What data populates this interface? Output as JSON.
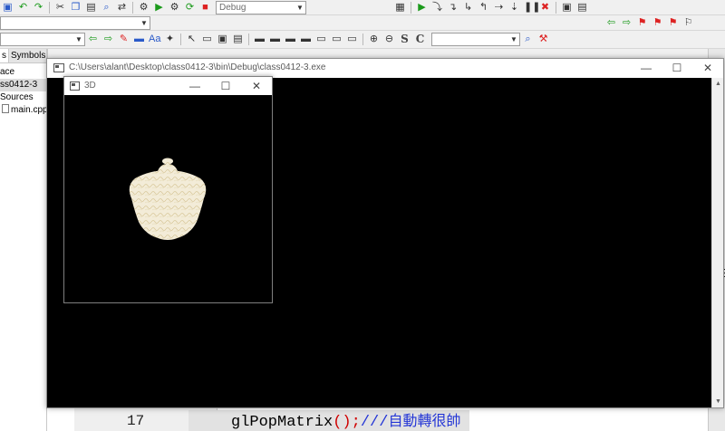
{
  "ide": {
    "build_target": "Debug",
    "tb3_combo_left": "",
    "tb3_combo_right": ""
  },
  "management": {
    "tabs": [
      "s",
      "Symbols"
    ],
    "items": [
      "ace",
      "ss0412-3",
      "Sources",
      "main.cpp"
    ]
  },
  "editor": {
    "line_number": "17",
    "code_fn": "glPopMatrix",
    "code_op": "();",
    "code_comment": "///",
    "code_comment_cjk": "自動轉很帥"
  },
  "console_window": {
    "title": "C:\\Users\\alant\\Desktop\\class0412-3\\bin\\Debug\\class0412-3.exe",
    "minimize": "—",
    "maximize": "☐",
    "close": "✕"
  },
  "gl_window": {
    "title": "3D",
    "minimize": "—",
    "maximize": "☐",
    "close": "✕"
  },
  "right_edge_letter": "E",
  "colors": {
    "console_bg": "#000000",
    "teapot": "#f3ecd8",
    "comment": "#2436d6",
    "operator": "#d00000"
  }
}
